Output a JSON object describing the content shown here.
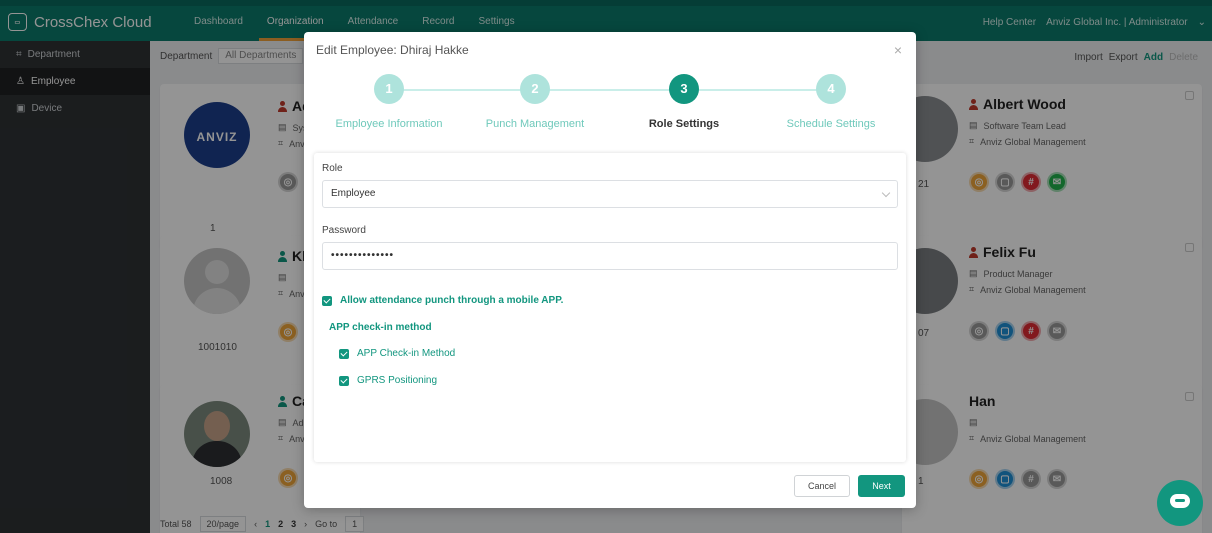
{
  "app": {
    "brand": "CrossChex Cloud",
    "logo_text": "ANVIZ",
    "nav": [
      "Dashboard",
      "Organization",
      "Attendance",
      "Record",
      "Settings"
    ],
    "help": "Help Center",
    "account": "Anviz Global Inc. | Administrator"
  },
  "sidebar": {
    "items": [
      {
        "label": "Department",
        "icon": "org-tree-icon"
      },
      {
        "label": "Employee",
        "icon": "person-icon"
      },
      {
        "label": "Device",
        "icon": "device-icon"
      }
    ]
  },
  "toolbar": {
    "department_label": "Department",
    "department_value": "All Departments",
    "import": "Import",
    "export": "Export",
    "add": "Add",
    "delete": "Delete"
  },
  "cards": [
    {
      "id": "1",
      "name": "Ad",
      "pos": "Sys",
      "dept": "Anv",
      "avatar_text": "ANVIZ"
    },
    {
      "id": "1001010",
      "name": "Kh",
      "pos": "",
      "dept": "Anv"
    },
    {
      "id": "1008",
      "name": "Ca",
      "pos": "Adr",
      "dept": "Anv"
    },
    {
      "id": "21",
      "name": "Albert Wood",
      "pos": "Software Team Lead",
      "dept": "Anviz Global Management"
    },
    {
      "id": "07",
      "name": "Felix Fu",
      "pos": "Product Manager",
      "dept": "Anviz Global Management"
    },
    {
      "id": "1",
      "name": "Han",
      "pos": "",
      "dept": "Anviz Global Management"
    }
  ],
  "pager": {
    "total": "Total 58",
    "per_page": "20/page",
    "pages": [
      "1",
      "2",
      "3"
    ],
    "goto_label": "Go to",
    "goto_value": "1"
  },
  "modal": {
    "title": "Edit Employee: Dhiraj Hakke",
    "steps": [
      {
        "num": "1",
        "label": "Employee Information"
      },
      {
        "num": "2",
        "label": "Punch Management"
      },
      {
        "num": "3",
        "label": "Role Settings"
      },
      {
        "num": "4",
        "label": "Schedule Settings"
      }
    ],
    "active_step": 3,
    "role_label": "Role",
    "role_value": "Employee",
    "password_label": "Password",
    "password_value": "••••••••••••••",
    "allow_app": "Allow attendance punch through a mobile APP.",
    "method_heading": "APP check-in method",
    "method_1": "APP Check-in Method",
    "method_2": "GPRS Positioning",
    "cancel": "Cancel",
    "next": "Next"
  },
  "colors": {
    "accent": "#12967f",
    "topbar": "#0c7a6b",
    "sidebar": "#2f3235"
  }
}
